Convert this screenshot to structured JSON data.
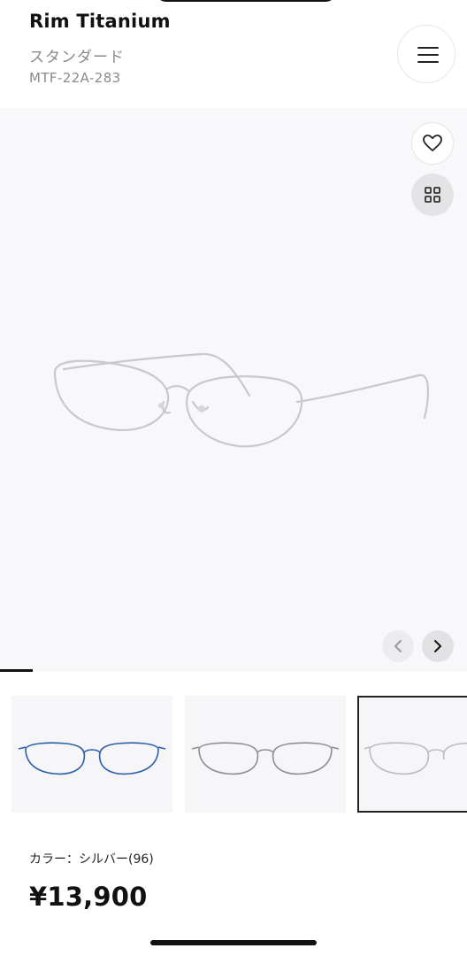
{
  "product": {
    "name": "Rim Titanium",
    "series": "スタンダード",
    "model_code": "MTF-22A-283",
    "color_label": "カラー：シルバー(96)",
    "price": "¥13,900"
  },
  "gallery": {
    "slide_progress": 0.07,
    "thumbnails": [
      {
        "color": "blue"
      },
      {
        "color": "gunmetal"
      },
      {
        "color": "silver",
        "selected": true
      }
    ]
  },
  "icons": {
    "menu": "hamburger-menu-icon",
    "favorite": "heart-icon",
    "grid": "grid-icon",
    "prev": "chevron-left-icon",
    "next": "chevron-right-icon"
  },
  "colors": {
    "frame_blue": "#2a5ea8",
    "frame_gunmetal": "#8e8e92",
    "frame_silver": "#b9bbc0",
    "text_muted": "#8a8a8a"
  }
}
